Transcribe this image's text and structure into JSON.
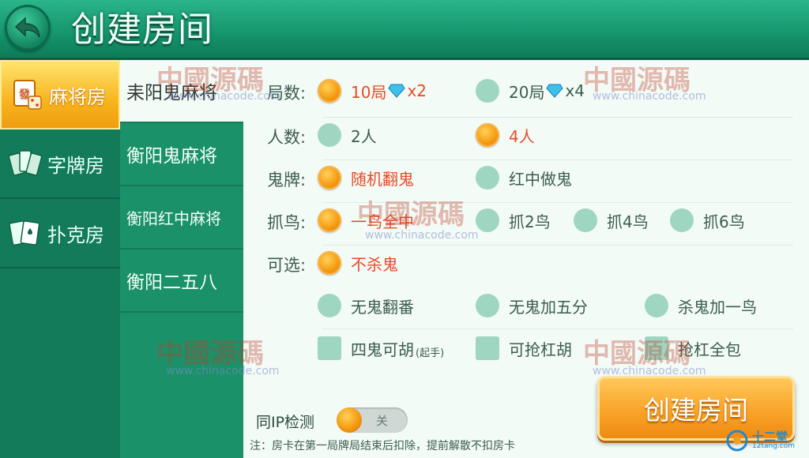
{
  "header": {
    "title": "创建房间"
  },
  "categories": [
    {
      "label": "麻将房",
      "icon": "mahjong-tile-icon"
    },
    {
      "label": "字牌房",
      "icon": "word-cards-icon"
    },
    {
      "label": "扑克房",
      "icon": "poker-cards-icon"
    }
  ],
  "variants": [
    {
      "label": "耒阳鬼麻将"
    },
    {
      "label": "衡阳鬼麻将"
    },
    {
      "label": "衡阳红中麻将"
    },
    {
      "label": "衡阳二五八"
    }
  ],
  "settings": {
    "rounds": {
      "label": "局数:",
      "opt1": "10局",
      "opt1_mult": "x2",
      "opt2": "20局",
      "opt2_mult": "x4"
    },
    "players": {
      "label": "人数:",
      "opt1": "2人",
      "opt2": "4人"
    },
    "ghost": {
      "label": "鬼牌:",
      "opt1": "随机翻鬼",
      "opt2": "红中做鬼"
    },
    "birds": {
      "label": "抓鸟:",
      "opt1": "一鸟全中",
      "opt2": "抓2鸟",
      "opt3": "抓4鸟",
      "opt4": "抓6鸟"
    },
    "optional": {
      "label": "可选:",
      "opt1": "不杀鬼",
      "opt2": "无鬼翻番",
      "opt3": "无鬼加五分",
      "opt4": "杀鬼加一鸟",
      "opt5": "四鬼可胡",
      "opt5_sub": "(起手)",
      "opt6": "可抢杠胡",
      "opt7": "抢杠全包"
    }
  },
  "ip_check": {
    "label": "同IP检测",
    "state": "关"
  },
  "note": "注：房卡在第一局牌局结束后扣除，提前解散不扣房卡",
  "create_button": "创建房间",
  "watermark": {
    "text": "中國源碼",
    "url": "www.chinacode.com"
  },
  "corner_logo": {
    "text": "十二堂",
    "sub": "12tang.com"
  },
  "colors": {
    "accent": "#f59a10",
    "selected_text": "#e84a2a",
    "header_green": "#15946c"
  }
}
